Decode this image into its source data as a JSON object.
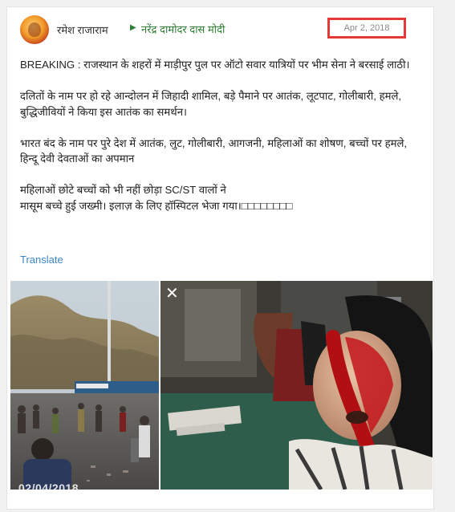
{
  "post": {
    "author": "रमेश राजाराम",
    "target": "नरेंद्र दामोदर दास मोदी",
    "date": "Apr 2, 2018",
    "paragraphs": [
      "BREAKING : राजस्थान के शहरों में माड़ीपुर पुल पर ऑटो सवार यात्रियों पर भीम सेना ने बरसाई लाठी।",
      "दलितों के नाम पर हो रहे आन्दोलन में जिहादी शामिल, बड़े पैमाने पर आतंक, लूटपाट, गोलीबारी, हमले, बुद्धिजीवियों ने किया इस आतंक का समर्थन।",
      "भारत बंद के नाम पर पुरे देश में आतंक, लुट, गोलीबारी, आगजनी, महिलाओं का शोषण, बच्चों पर हमले, हिन्दू देवी देवताओं का अपमान",
      "महिलाओं छोटे बच्चों को भी नहीं छोड़ा SC/ST वालों ने\nमासूम बच्चे हुई जख्मी। इलाज़ के लिए हॉस्पिटल भेजा गया।□□□□□□□□"
    ],
    "translate_label": "Translate",
    "photo_left_date": "02/04/2018",
    "close_icon_glyph": "✕"
  },
  "colors": {
    "link": "#3a86c8",
    "target_green": "#2e7d32",
    "highlight_box": "#e53935"
  },
  "icons": [
    "avatar",
    "triangle-right-icon",
    "close-icon"
  ]
}
